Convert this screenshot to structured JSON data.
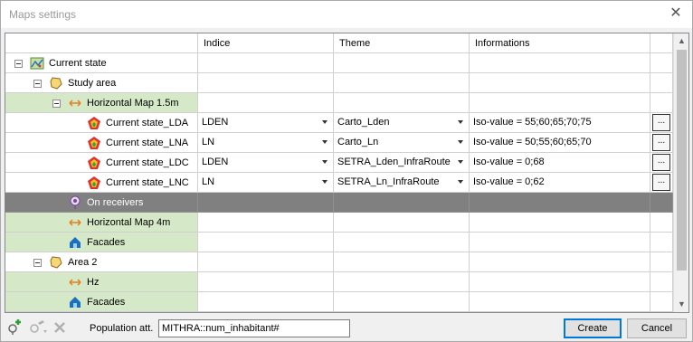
{
  "window": {
    "title": "Maps settings"
  },
  "columns": [
    "",
    "Indice",
    "Theme",
    "Informations"
  ],
  "rows": [
    {
      "level": 0,
      "expander": true,
      "icon": "map-icon",
      "label": "Current state",
      "style": "plain",
      "indice": "",
      "theme": "",
      "info": "",
      "button": ""
    },
    {
      "level": 1,
      "expander": true,
      "icon": "area-polygon-icon",
      "label": "Study area",
      "style": "plain",
      "indice": "",
      "theme": "",
      "info": "",
      "button": ""
    },
    {
      "level": 2,
      "expander": true,
      "icon": "horizontal-arrows-icon",
      "label": "Horizontal Map 1.5m",
      "style": "green",
      "indice": "",
      "theme": "",
      "info": "",
      "button": ""
    },
    {
      "level": 3,
      "expander": false,
      "icon": "noise-map-icon",
      "label": "Current state_LDA",
      "style": "plain",
      "indice": "LDEN",
      "theme": "Carto_Lden",
      "info": "Iso-value = 55;60;65;70;75",
      "button": "..."
    },
    {
      "level": 3,
      "expander": false,
      "icon": "noise-map-icon",
      "label": "Current state_LNA",
      "style": "plain",
      "indice": "LN",
      "theme": "Carto_Ln",
      "info": "Iso-value = 50;55;60;65;70",
      "button": "..."
    },
    {
      "level": 3,
      "expander": false,
      "icon": "noise-map-icon",
      "label": "Current state_LDC",
      "style": "plain",
      "indice": "LDEN",
      "theme": "SETRA_Lden_InfraRoute",
      "info": "Iso-value = 0;68",
      "button": "..."
    },
    {
      "level": 3,
      "expander": false,
      "icon": "noise-map-icon",
      "label": "Current state_LNC",
      "style": "plain",
      "indice": "LN",
      "theme": "SETRA_Ln_InfraRoute",
      "info": "Iso-value = 0;62",
      "button": "..."
    },
    {
      "level": 2,
      "expander": false,
      "icon": "receiver-icon",
      "label": "On receivers",
      "style": "selected",
      "indice": "",
      "theme": "",
      "info": "",
      "button": ""
    },
    {
      "level": 2,
      "expander": false,
      "icon": "horizontal-arrows-icon",
      "label": "Horizontal Map 4m",
      "style": "green",
      "indice": "",
      "theme": "",
      "info": "",
      "button": ""
    },
    {
      "level": 2,
      "expander": false,
      "icon": "facade-icon",
      "label": "Facades",
      "style": "green",
      "indice": "",
      "theme": "",
      "info": "",
      "button": ""
    },
    {
      "level": 1,
      "expander": true,
      "icon": "area-polygon-icon",
      "label": "Area 2",
      "style": "plain",
      "indice": "",
      "theme": "",
      "info": "",
      "button": ""
    },
    {
      "level": 2,
      "expander": false,
      "icon": "horizontal-arrows-icon",
      "label": "Hz",
      "style": "green",
      "indice": "",
      "theme": "",
      "info": "",
      "button": ""
    },
    {
      "level": 2,
      "expander": false,
      "icon": "facade-icon",
      "label": "Facades",
      "style": "green",
      "indice": "",
      "theme": "",
      "info": "",
      "button": ""
    }
  ],
  "bottom": {
    "population_label": "Population att.",
    "population_value": "MITHRA::num_inhabitant#",
    "create_label": "Create",
    "cancel_label": "Cancel"
  },
  "colors": {
    "green_row": "#d5e8c7",
    "selected_row": "#808080",
    "accent": "#0078d7"
  }
}
